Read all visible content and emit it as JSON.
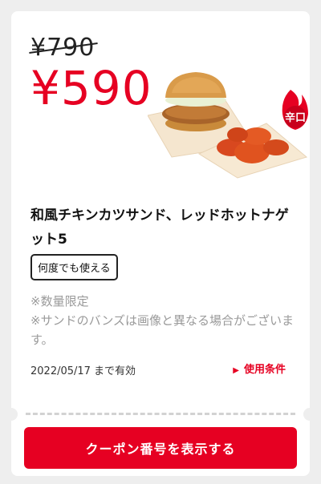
{
  "coupon": {
    "old_price": "¥790",
    "new_price": "¥590",
    "spicy_badge": "辛口",
    "title": "和風チキンカツサンド、レッドホットナゲット5",
    "usage_badge": "何度でも使える",
    "notes": [
      "※数量限定",
      "※サンドのバンズは画像と異なる場合がございます。"
    ],
    "validity": "2022/05/17 まで有効",
    "conditions_link": "使用条件",
    "cta_label": "クーポン番号を表示する"
  },
  "colors": {
    "accent": "#e60022",
    "background": "#eeeeee",
    "card": "#ffffff",
    "muted_text": "#9a9a9a"
  },
  "icons": {
    "conditions_arrow": "play-triangle-icon",
    "spicy_badge": "flame-icon"
  }
}
